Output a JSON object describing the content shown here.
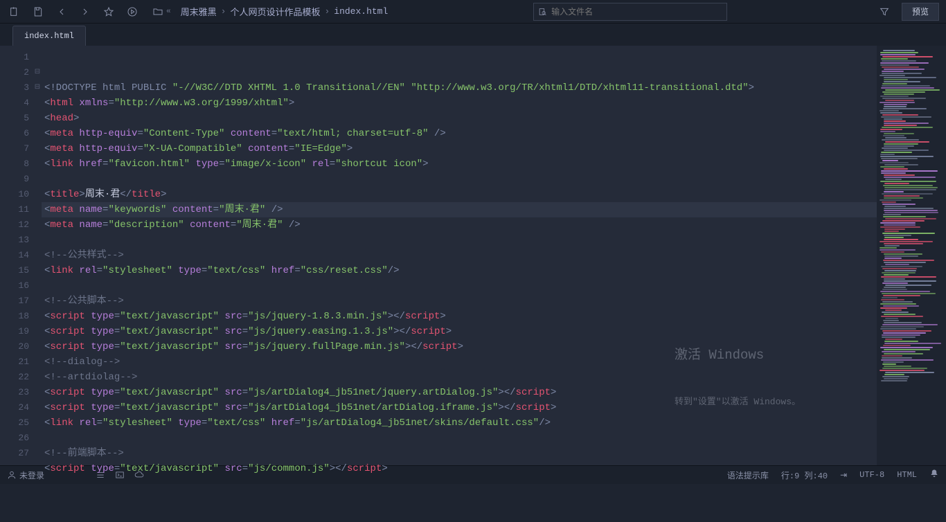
{
  "toolbar": {
    "search_placeholder": "输入文件名",
    "preview_label": "预览"
  },
  "breadcrumb": {
    "items": [
      "周末雅黑",
      "个人网页设计作品模板",
      "index.html"
    ]
  },
  "tabs": {
    "active": "index.html"
  },
  "code_lines": [
    {
      "n": 1,
      "fold": "",
      "tokens": [
        [
          "p",
          "<!DOCTYPE html PUBLIC "
        ],
        [
          "av",
          "\"-//W3C//DTD XHTML 1.0 Transitional//EN\""
        ],
        [
          "p",
          " "
        ],
        [
          "av",
          "\"http://www.w3.org/TR/xhtml1/DTD/xhtml11-transitional.dtd\""
        ],
        [
          "p",
          ">"
        ]
      ]
    },
    {
      "n": 2,
      "fold": "⊟",
      "tokens": [
        [
          "p",
          "<"
        ],
        [
          "tg",
          "html"
        ],
        [
          "p",
          " "
        ],
        [
          "an",
          "xmlns"
        ],
        [
          "p",
          "="
        ],
        [
          "av",
          "\"http://www.w3.org/1999/xhtml\""
        ],
        [
          "p",
          ">"
        ]
      ]
    },
    {
      "n": 3,
      "fold": "⊟",
      "tokens": [
        [
          "p",
          "<"
        ],
        [
          "tg",
          "head"
        ],
        [
          "p",
          ">"
        ]
      ]
    },
    {
      "n": 4,
      "fold": "",
      "tokens": [
        [
          "p",
          "<"
        ],
        [
          "tg",
          "meta"
        ],
        [
          "p",
          " "
        ],
        [
          "an",
          "http-equiv"
        ],
        [
          "p",
          "="
        ],
        [
          "av",
          "\"Content-Type\""
        ],
        [
          "p",
          " "
        ],
        [
          "an",
          "content"
        ],
        [
          "p",
          "="
        ],
        [
          "av",
          "\"text/html; charset=utf-8\""
        ],
        [
          "p",
          " />"
        ]
      ]
    },
    {
      "n": 5,
      "fold": "",
      "tokens": [
        [
          "p",
          "<"
        ],
        [
          "tg",
          "meta"
        ],
        [
          "p",
          " "
        ],
        [
          "an",
          "http-equiv"
        ],
        [
          "p",
          "="
        ],
        [
          "av",
          "\"X-UA-Compatible\""
        ],
        [
          "p",
          " "
        ],
        [
          "an",
          "content"
        ],
        [
          "p",
          "="
        ],
        [
          "av",
          "\"IE=Edge\""
        ],
        [
          "p",
          ">"
        ]
      ]
    },
    {
      "n": 6,
      "fold": "",
      "tokens": [
        [
          "p",
          "<"
        ],
        [
          "tg",
          "link"
        ],
        [
          "p",
          " "
        ],
        [
          "an",
          "href"
        ],
        [
          "p",
          "="
        ],
        [
          "av",
          "\"favicon.html\""
        ],
        [
          "p",
          " "
        ],
        [
          "an",
          "type"
        ],
        [
          "p",
          "="
        ],
        [
          "av",
          "\"image/x-icon\""
        ],
        [
          "p",
          " "
        ],
        [
          "an",
          "rel"
        ],
        [
          "p",
          "="
        ],
        [
          "av",
          "\"shortcut icon\""
        ],
        [
          "p",
          ">"
        ]
      ]
    },
    {
      "n": 7,
      "fold": "",
      "tokens": [
        [
          "tx",
          ""
        ]
      ]
    },
    {
      "n": 8,
      "fold": "",
      "tokens": [
        [
          "p",
          "<"
        ],
        [
          "tg",
          "title"
        ],
        [
          "p",
          ">"
        ],
        [
          "tx",
          "周末·君"
        ],
        [
          "p",
          "</"
        ],
        [
          "tg",
          "title"
        ],
        [
          "p",
          ">"
        ]
      ]
    },
    {
      "n": 9,
      "fold": "",
      "cur": true,
      "tokens": [
        [
          "p",
          "<"
        ],
        [
          "tg",
          "meta"
        ],
        [
          "p",
          " "
        ],
        [
          "an",
          "name"
        ],
        [
          "p",
          "="
        ],
        [
          "av",
          "\"keywords\""
        ],
        [
          "p",
          " "
        ],
        [
          "an",
          "content"
        ],
        [
          "p",
          "="
        ],
        [
          "av",
          "\"周末·君\""
        ],
        [
          "p",
          " />"
        ]
      ]
    },
    {
      "n": 10,
      "fold": "",
      "tokens": [
        [
          "p",
          "<"
        ],
        [
          "tg",
          "meta"
        ],
        [
          "p",
          " "
        ],
        [
          "an",
          "name"
        ],
        [
          "p",
          "="
        ],
        [
          "av",
          "\"description\""
        ],
        [
          "p",
          " "
        ],
        [
          "an",
          "content"
        ],
        [
          "p",
          "="
        ],
        [
          "av",
          "\"周末·君\""
        ],
        [
          "p",
          " />"
        ]
      ]
    },
    {
      "n": 11,
      "fold": "",
      "tokens": [
        [
          "tx",
          ""
        ]
      ]
    },
    {
      "n": 12,
      "fold": "",
      "tokens": [
        [
          "cm",
          "<!--公共样式-->"
        ]
      ]
    },
    {
      "n": 13,
      "fold": "",
      "tokens": [
        [
          "p",
          "<"
        ],
        [
          "tg",
          "link"
        ],
        [
          "p",
          " "
        ],
        [
          "an",
          "rel"
        ],
        [
          "p",
          "="
        ],
        [
          "av",
          "\"stylesheet\""
        ],
        [
          "p",
          " "
        ],
        [
          "an",
          "type"
        ],
        [
          "p",
          "="
        ],
        [
          "av",
          "\"text/css\""
        ],
        [
          "p",
          " "
        ],
        [
          "an",
          "href"
        ],
        [
          "p",
          "="
        ],
        [
          "av",
          "\"css/reset.css\""
        ],
        [
          "p",
          "/>"
        ]
      ]
    },
    {
      "n": 14,
      "fold": "",
      "tokens": [
        [
          "tx",
          ""
        ]
      ]
    },
    {
      "n": 15,
      "fold": "",
      "tokens": [
        [
          "cm",
          "<!--公共脚本-->"
        ]
      ]
    },
    {
      "n": 16,
      "fold": "",
      "tokens": [
        [
          "p",
          "<"
        ],
        [
          "tg",
          "script"
        ],
        [
          "p",
          " "
        ],
        [
          "an",
          "type"
        ],
        [
          "p",
          "="
        ],
        [
          "av",
          "\"text/javascript\""
        ],
        [
          "p",
          " "
        ],
        [
          "an",
          "src"
        ],
        [
          "p",
          "="
        ],
        [
          "av",
          "\"js/jquery-1.8.3.min.js\""
        ],
        [
          "p",
          "></"
        ],
        [
          "tg",
          "script"
        ],
        [
          "p",
          ">"
        ]
      ]
    },
    {
      "n": 17,
      "fold": "",
      "tokens": [
        [
          "p",
          "<"
        ],
        [
          "tg",
          "script"
        ],
        [
          "p",
          " "
        ],
        [
          "an",
          "type"
        ],
        [
          "p",
          "="
        ],
        [
          "av",
          "\"text/javascript\""
        ],
        [
          "p",
          " "
        ],
        [
          "an",
          "src"
        ],
        [
          "p",
          "="
        ],
        [
          "av",
          "\"js/jquery.easing.1.3.js\""
        ],
        [
          "p",
          "></"
        ],
        [
          "tg",
          "script"
        ],
        [
          "p",
          ">"
        ]
      ]
    },
    {
      "n": 18,
      "fold": "",
      "tokens": [
        [
          "p",
          "<"
        ],
        [
          "tg",
          "script"
        ],
        [
          "p",
          " "
        ],
        [
          "an",
          "type"
        ],
        [
          "p",
          "="
        ],
        [
          "av",
          "\"text/javascript\""
        ],
        [
          "p",
          " "
        ],
        [
          "an",
          "src"
        ],
        [
          "p",
          "="
        ],
        [
          "av",
          "\"js/jquery.fullPage.min.js\""
        ],
        [
          "p",
          "></"
        ],
        [
          "tg",
          "script"
        ],
        [
          "p",
          ">"
        ]
      ]
    },
    {
      "n": 19,
      "fold": "",
      "tokens": [
        [
          "cm",
          "<!--dialog-->"
        ]
      ]
    },
    {
      "n": 20,
      "fold": "",
      "tokens": [
        [
          "cm",
          "<!--artdiolag-->"
        ]
      ]
    },
    {
      "n": 21,
      "fold": "",
      "tokens": [
        [
          "p",
          "<"
        ],
        [
          "tg",
          "script"
        ],
        [
          "p",
          " "
        ],
        [
          "an",
          "type"
        ],
        [
          "p",
          "="
        ],
        [
          "av",
          "\"text/javascript\""
        ],
        [
          "p",
          " "
        ],
        [
          "an",
          "src"
        ],
        [
          "p",
          "="
        ],
        [
          "av",
          "\"js/artDialog4_jb51net/jquery.artDialog.js\""
        ],
        [
          "p",
          "></"
        ],
        [
          "tg",
          "script"
        ],
        [
          "p",
          ">"
        ]
      ]
    },
    {
      "n": 22,
      "fold": "",
      "tokens": [
        [
          "p",
          "<"
        ],
        [
          "tg",
          "script"
        ],
        [
          "p",
          " "
        ],
        [
          "an",
          "type"
        ],
        [
          "p",
          "="
        ],
        [
          "av",
          "\"text/javascript\""
        ],
        [
          "p",
          " "
        ],
        [
          "an",
          "src"
        ],
        [
          "p",
          "="
        ],
        [
          "av",
          "\"js/artDialog4_jb51net/artDialog.iframe.js\""
        ],
        [
          "p",
          "></"
        ],
        [
          "tg",
          "script"
        ],
        [
          "p",
          ">"
        ]
      ]
    },
    {
      "n": 23,
      "fold": "",
      "tokens": [
        [
          "p",
          "<"
        ],
        [
          "tg",
          "link"
        ],
        [
          "p",
          " "
        ],
        [
          "an",
          "rel"
        ],
        [
          "p",
          "="
        ],
        [
          "av",
          "\"stylesheet\""
        ],
        [
          "p",
          " "
        ],
        [
          "an",
          "type"
        ],
        [
          "p",
          "="
        ],
        [
          "av",
          "\"text/css\""
        ],
        [
          "p",
          " "
        ],
        [
          "an",
          "href"
        ],
        [
          "p",
          "="
        ],
        [
          "av",
          "\"js/artDialog4_jb51net/skins/default.css\""
        ],
        [
          "p",
          "/>"
        ]
      ]
    },
    {
      "n": 24,
      "fold": "",
      "tokens": [
        [
          "tx",
          ""
        ]
      ]
    },
    {
      "n": 25,
      "fold": "",
      "tokens": [
        [
          "cm",
          "<!--前端脚本-->"
        ]
      ]
    },
    {
      "n": 26,
      "fold": "",
      "tokens": [
        [
          "p",
          "<"
        ],
        [
          "tg",
          "script"
        ],
        [
          "p",
          " "
        ],
        [
          "an",
          "type"
        ],
        [
          "p",
          "="
        ],
        [
          "av",
          "\"text/javascript\""
        ],
        [
          "p",
          " "
        ],
        [
          "an",
          "src"
        ],
        [
          "p",
          "="
        ],
        [
          "av",
          "\"js/common.js\""
        ],
        [
          "p",
          "></"
        ],
        [
          "tg",
          "script"
        ],
        [
          "p",
          ">"
        ]
      ]
    },
    {
      "n": 27,
      "fold": "",
      "tokens": [
        [
          "tx",
          ""
        ]
      ]
    }
  ],
  "statusbar": {
    "login": "未登录",
    "syntax": "语法提示库",
    "cursor": "行:9 列:40",
    "encoding": "UTF-8",
    "language": "HTML"
  },
  "watermark": {
    "title": "激活 Windows",
    "sub": "转到\"设置\"以激活 Windows。"
  },
  "minimap_colors": [
    "#7f8aa8",
    "#e55472",
    "#86c36a",
    "#b77fdb",
    "#6c748a"
  ]
}
